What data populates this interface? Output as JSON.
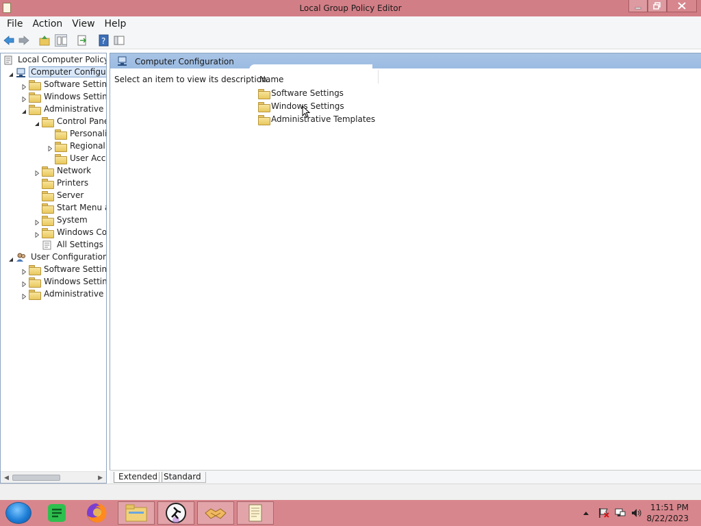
{
  "window": {
    "title": "Local Group Policy Editor"
  },
  "menu": [
    "File",
    "Action",
    "View",
    "Help"
  ],
  "tree": {
    "root": "Local Computer Policy",
    "items": [
      {
        "label": "Computer Configurati",
        "level": 1,
        "expanded": true,
        "icon": "computer-icon",
        "selected": true
      },
      {
        "label": "Software Settings",
        "level": 2,
        "expanded": false,
        "icon": "folder-icon"
      },
      {
        "label": "Windows Settings",
        "level": 2,
        "expanded": false,
        "icon": "folder-icon"
      },
      {
        "label": "Administrative Ten",
        "level": 2,
        "expanded": true,
        "icon": "folder-icon"
      },
      {
        "label": "Control Panel",
        "level": 3,
        "expanded": true,
        "icon": "folder-icon"
      },
      {
        "label": "Personaliz",
        "level": 4,
        "icon": "folder-icon"
      },
      {
        "label": "Regional a",
        "level": 4,
        "expanded": false,
        "icon": "folder-icon"
      },
      {
        "label": "User Acco",
        "level": 4,
        "icon": "folder-icon"
      },
      {
        "label": "Network",
        "level": 3,
        "expanded": false,
        "icon": "folder-icon"
      },
      {
        "label": "Printers",
        "level": 3,
        "icon": "folder-icon"
      },
      {
        "label": "Server",
        "level": 3,
        "icon": "folder-icon"
      },
      {
        "label": "Start Menu an",
        "level": 3,
        "icon": "folder-icon"
      },
      {
        "label": "System",
        "level": 3,
        "expanded": false,
        "icon": "folder-icon"
      },
      {
        "label": "Windows Com",
        "level": 3,
        "expanded": false,
        "icon": "folder-icon"
      },
      {
        "label": "All Settings",
        "level": 3,
        "icon": "settings-icon"
      },
      {
        "label": "User Configuration",
        "level": 1,
        "expanded": true,
        "icon": "users-icon"
      },
      {
        "label": "Software Settings",
        "level": 2,
        "expanded": false,
        "icon": "folder-icon"
      },
      {
        "label": "Windows Settings",
        "level": 2,
        "expanded": false,
        "icon": "folder-icon"
      },
      {
        "label": "Administrative Ten",
        "level": 2,
        "expanded": false,
        "icon": "folder-icon"
      }
    ]
  },
  "details": {
    "header": "Computer Configuration",
    "description": "Select an item to view its description.",
    "column": "Name",
    "items": [
      "Software Settings",
      "Windows Settings",
      "Administrative Templates"
    ]
  },
  "tabs": {
    "extended": "Extended",
    "standard": "Standard"
  },
  "clock": {
    "time": "11:51 PM",
    "date": "8/22/2023"
  },
  "colors": {
    "titlebar": "#d27e86",
    "taskbar": "#d8868d",
    "header": "#a8c4e6",
    "selection": "#d9e7f8"
  }
}
